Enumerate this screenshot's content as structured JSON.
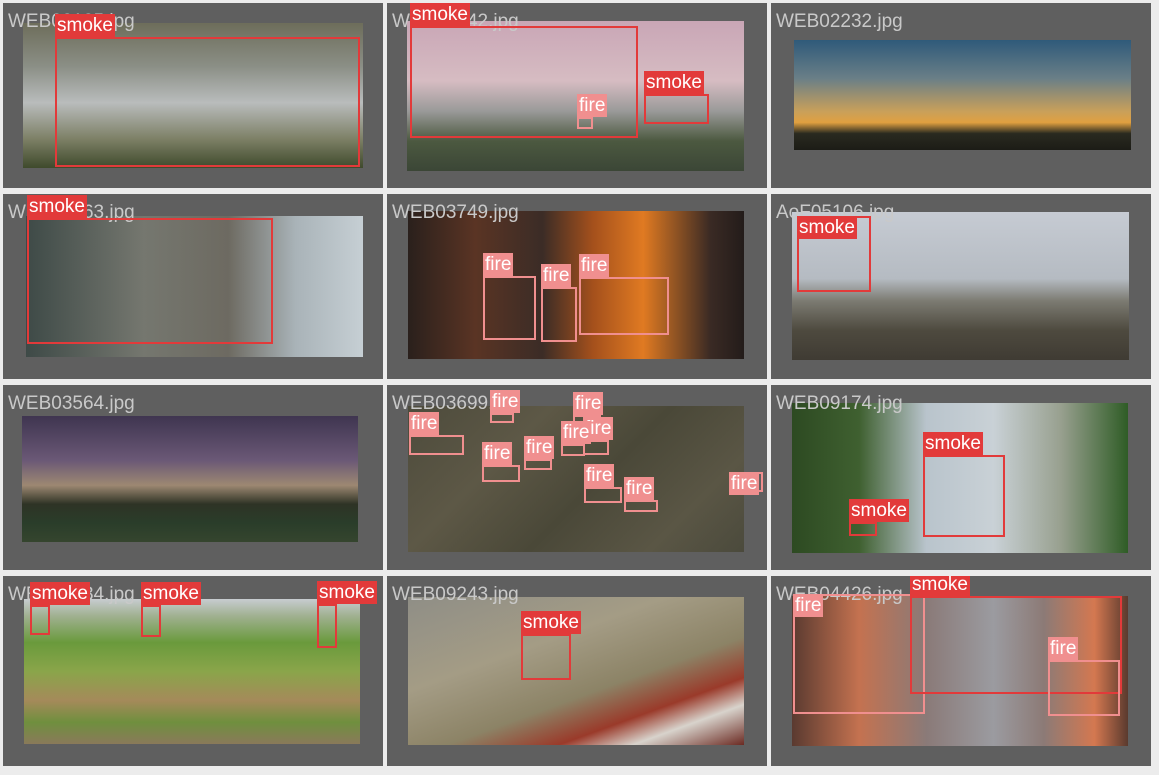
{
  "grid": {
    "tiles": [
      {
        "filename": "WEB02125.jpg",
        "detections": [
          {
            "label": "smoke",
            "kind": "smoke"
          }
        ]
      },
      {
        "filename": "WEB02042.jpg",
        "detections": [
          {
            "label": "smoke",
            "kind": "smoke"
          },
          {
            "label": "fire",
            "kind": "fire"
          },
          {
            "label": "smoke",
            "kind": "smoke"
          }
        ]
      },
      {
        "filename": "WEB02232.jpg",
        "detections": []
      },
      {
        "filename": "WEB00063.jpg",
        "detections": [
          {
            "label": "smoke",
            "kind": "smoke"
          }
        ]
      },
      {
        "filename": "WEB03749.jpg",
        "detections": [
          {
            "label": "fire",
            "kind": "fire"
          },
          {
            "label": "fire",
            "kind": "fire"
          },
          {
            "label": "fire",
            "kind": "fire"
          }
        ]
      },
      {
        "filename": "AoF05106.jpg",
        "detections": [
          {
            "label": "smoke",
            "kind": "smoke"
          }
        ]
      },
      {
        "filename": "WEB03564.jpg",
        "detections": []
      },
      {
        "filename": "WEB03699.jpg",
        "detections": [
          {
            "label": "fire",
            "kind": "fire"
          },
          {
            "label": "fire",
            "kind": "fire"
          },
          {
            "label": "fire",
            "kind": "fire"
          },
          {
            "label": "fire",
            "kind": "fire"
          },
          {
            "label": "fire",
            "kind": "fire"
          },
          {
            "label": "fire",
            "kind": "fire"
          },
          {
            "label": "fire",
            "kind": "fire"
          },
          {
            "label": "fire",
            "kind": "fire"
          },
          {
            "label": "fire",
            "kind": "fire"
          },
          {
            "label": "fire",
            "kind": "fire"
          }
        ]
      },
      {
        "filename": "WEB09174.jpg",
        "detections": [
          {
            "label": "smoke",
            "kind": "smoke"
          },
          {
            "label": "smoke",
            "kind": "smoke"
          }
        ]
      },
      {
        "filename": "WEB00034.jpg",
        "detections": [
          {
            "label": "smoke",
            "kind": "smoke"
          },
          {
            "label": "smoke",
            "kind": "smoke"
          },
          {
            "label": "smoke",
            "kind": "smoke"
          }
        ]
      },
      {
        "filename": "WEB09243.jpg",
        "detections": [
          {
            "label": "smoke",
            "kind": "smoke"
          }
        ]
      },
      {
        "filename": "WEB04426.jpg",
        "detections": [
          {
            "label": "fire",
            "kind": "fire"
          },
          {
            "label": "smoke",
            "kind": "smoke"
          },
          {
            "label": "fire",
            "kind": "fire"
          }
        ]
      }
    ]
  },
  "colors": {
    "smoke_box": "#e23a3a",
    "fire_box": "#f08f8f",
    "tile_background": "#5f5f5f",
    "page_background": "#ececec",
    "filename_text": "#c9c9c9"
  }
}
